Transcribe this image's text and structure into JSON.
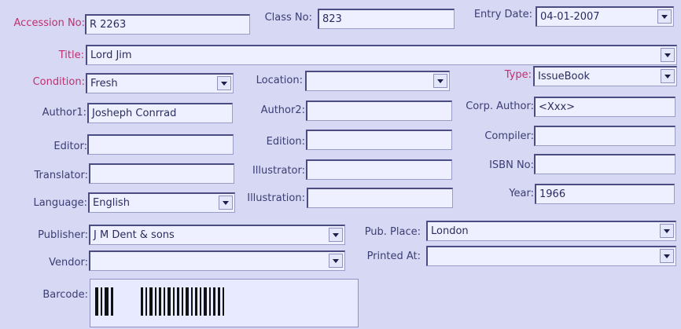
{
  "form": {
    "accession_label": "Accession No:",
    "accession_value": "R 2263",
    "class_label": "Class No:",
    "class_value": "823",
    "entry_date_label": "Entry Date:",
    "entry_date_value": "04-01-2007",
    "title_label": "Title:",
    "title_value": "Lord Jim",
    "condition_label": "Condition:",
    "condition_value": "Fresh",
    "location_label": "Location:",
    "location_value": "",
    "type_label": "Type:",
    "type_value": "IssueBook",
    "author1_label": "Author1:",
    "author1_value": "Josheph Conrrad",
    "author2_label": "Author2:",
    "author2_value": "",
    "corp_author_label": "Corp. Author:",
    "corp_author_value": "<Xxx>",
    "editor_label": "Editor:",
    "editor_value": "",
    "edition_label": "Edition:",
    "edition_value": "",
    "compiler_label": "Compiler:",
    "compiler_value": "",
    "translator_label": "Translator:",
    "translator_value": "",
    "illustrator_label": "Illustrator:",
    "illustrator_value": "",
    "isbn_label": "ISBN No:",
    "isbn_value": "",
    "language_label": "Language:",
    "language_value": "English",
    "illustration_label": "Illustration:",
    "illustration_value": "",
    "year_label": "Year:",
    "year_value": "1966",
    "publisher_label": "Publisher:",
    "publisher_value": "J M Dent & sons",
    "pub_place_label": "Pub. Place:",
    "pub_place_value": "London",
    "vendor_label": "Vendor:",
    "vendor_value": "",
    "printed_at_label": "Printed At:",
    "printed_at_value": "",
    "barcode_label": "Barcode:"
  },
  "colors": {
    "background": "#d6d8f4",
    "required_label": "#c0306e",
    "label": "#3b3d74"
  },
  "icons": {
    "dropdown": "chevron-down-icon"
  }
}
